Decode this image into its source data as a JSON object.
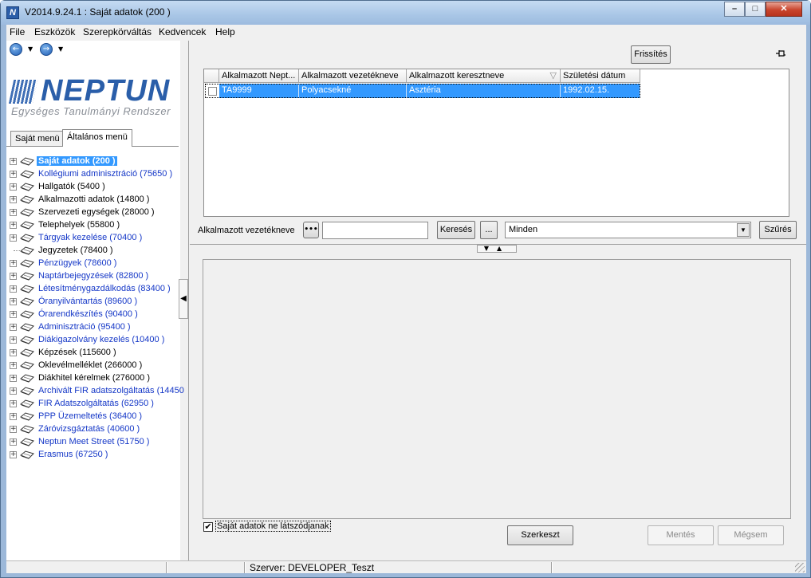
{
  "window": {
    "title": "V2014.9.24.1 : Saját adatok (200  )",
    "app_icon_letter": "N"
  },
  "menubar": [
    "File",
    "Eszközök",
    "Szerepkörváltás",
    "Kedvencek",
    "Help"
  ],
  "logo": {
    "name": "NEPTUN",
    "subtitle": "Egységes Tanulmányi Rendszer",
    "brand_color": "#2a5ea9"
  },
  "left_tabs": [
    "Saját menü",
    "Általános menü"
  ],
  "tree": [
    {
      "label": "Saját adatok (200  )",
      "style": "selected",
      "expandable": true
    },
    {
      "label": "Kollégiumi adminisztráció (75650  )",
      "style": "blue",
      "expandable": true
    },
    {
      "label": "Hallgatók (5400  )",
      "style": "black",
      "expandable": true
    },
    {
      "label": "Alkalmazotti adatok (14800  )",
      "style": "black",
      "expandable": true
    },
    {
      "label": "Szervezeti egységek (28000  )",
      "style": "black",
      "expandable": true
    },
    {
      "label": "Telephelyek (55800  )",
      "style": "black",
      "expandable": true
    },
    {
      "label": "Tárgyak kezelése (70400  )",
      "style": "blue",
      "expandable": true
    },
    {
      "label": "Jegyzetek (78400  )",
      "style": "black",
      "expandable": false
    },
    {
      "label": "Pénzügyek (78600  )",
      "style": "blue",
      "expandable": true
    },
    {
      "label": "Naptárbejegyzések (82800  )",
      "style": "blue",
      "expandable": true
    },
    {
      "label": "Létesítménygazdálkodás (83400  )",
      "style": "blue",
      "expandable": true
    },
    {
      "label": "Óranyilvántartás (89600  )",
      "style": "blue",
      "expandable": true
    },
    {
      "label": "Órarendkészítés (90400  )",
      "style": "blue",
      "expandable": true
    },
    {
      "label": "Adminisztráció (95400  )",
      "style": "blue",
      "expandable": true
    },
    {
      "label": "Diákigazolvány kezelés (10400  )",
      "style": "blue",
      "expandable": true
    },
    {
      "label": "Képzések (115600  )",
      "style": "black",
      "expandable": true
    },
    {
      "label": "Oklevélmelléklet (266000  )",
      "style": "black",
      "expandable": true
    },
    {
      "label": "Diákhitel kérelmek (276000  )",
      "style": "black",
      "expandable": true
    },
    {
      "label": "Archivált FIR adatszolgáltatás (14450",
      "style": "blue",
      "expandable": true
    },
    {
      "label": "FIR Adatszolgáltatás (62950  )",
      "style": "blue",
      "expandable": true
    },
    {
      "label": "PPP Üzemeltetés (36400  )",
      "style": "blue",
      "expandable": true
    },
    {
      "label": "Záróvizsgáztatás (40600  )",
      "style": "blue",
      "expandable": true
    },
    {
      "label": "Neptun Meet Street (51750  )",
      "style": "blue",
      "expandable": true
    },
    {
      "label": "Erasmus (67250  )",
      "style": "blue",
      "expandable": true
    }
  ],
  "toolbar": {
    "refresh_label": "Frissítés",
    "pin_icon": "pin-icon"
  },
  "grid": {
    "columns": [
      "Alkalmazott Nept...",
      "Alkalmazott vezetékneve",
      "Alkalmazott keresztneve",
      "Születési dátum"
    ],
    "sort_glyph": "▽",
    "rows": [
      {
        "cells": [
          "TA9999",
          "Polyacsekné",
          "Asztéria",
          "1992.02.15."
        ],
        "selected": true
      }
    ]
  },
  "search": {
    "label": "Alkalmazott vezetékneve",
    "dots_label": "•••",
    "value": "",
    "search_button": "Keresés",
    "ellipsis_button": "...",
    "combo_value": "Minden",
    "filter_button": "Szűrés"
  },
  "detail": {
    "hide_checkbox_label": "Saját adatok ne látszódjanak",
    "hide_checked": true,
    "checkmark": "✔",
    "edit_button": "Szerkeszt",
    "save_button": "Mentés",
    "cancel_button": "Mégsem"
  },
  "status": {
    "server": "Szerver: DEVELOPER_Teszt"
  },
  "colors": {
    "selection": "#3399ff",
    "menu_link": "#1437c7",
    "title_bar": "#a9c6e6"
  }
}
